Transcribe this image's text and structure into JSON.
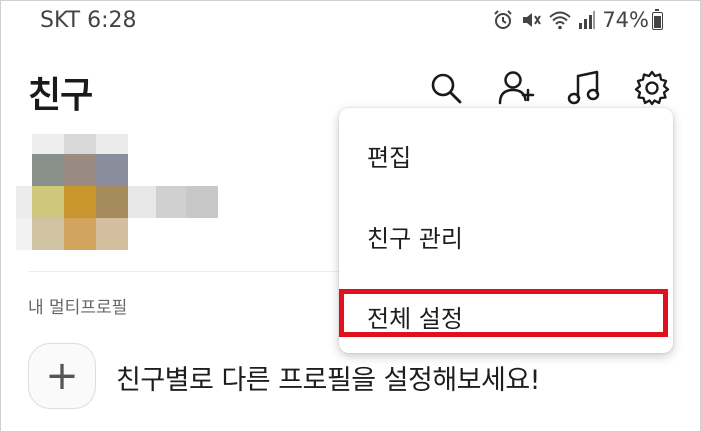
{
  "status_bar": {
    "carrier": "SKT",
    "time": "6:28",
    "battery": "74%",
    "battery_level": 0.74,
    "icons": [
      "alarm-icon",
      "mute-icon",
      "wifi-icon",
      "signal-icon",
      "battery-icon"
    ]
  },
  "header": {
    "title": "친구",
    "icons": [
      "search-icon",
      "add-friend-icon",
      "music-icon",
      "settings-icon"
    ]
  },
  "section": {
    "multi_profile_label": "내 멀티프로필"
  },
  "multi_profile": {
    "add_symbol": "+",
    "prompt": "친구별로 다른 프로필을 설정해보세요!"
  },
  "menu": {
    "items": [
      "편집",
      "친구 관리",
      "전체 설정"
    ],
    "highlighted_item": "전체 설정",
    "highlight_color": "#e0101d"
  }
}
